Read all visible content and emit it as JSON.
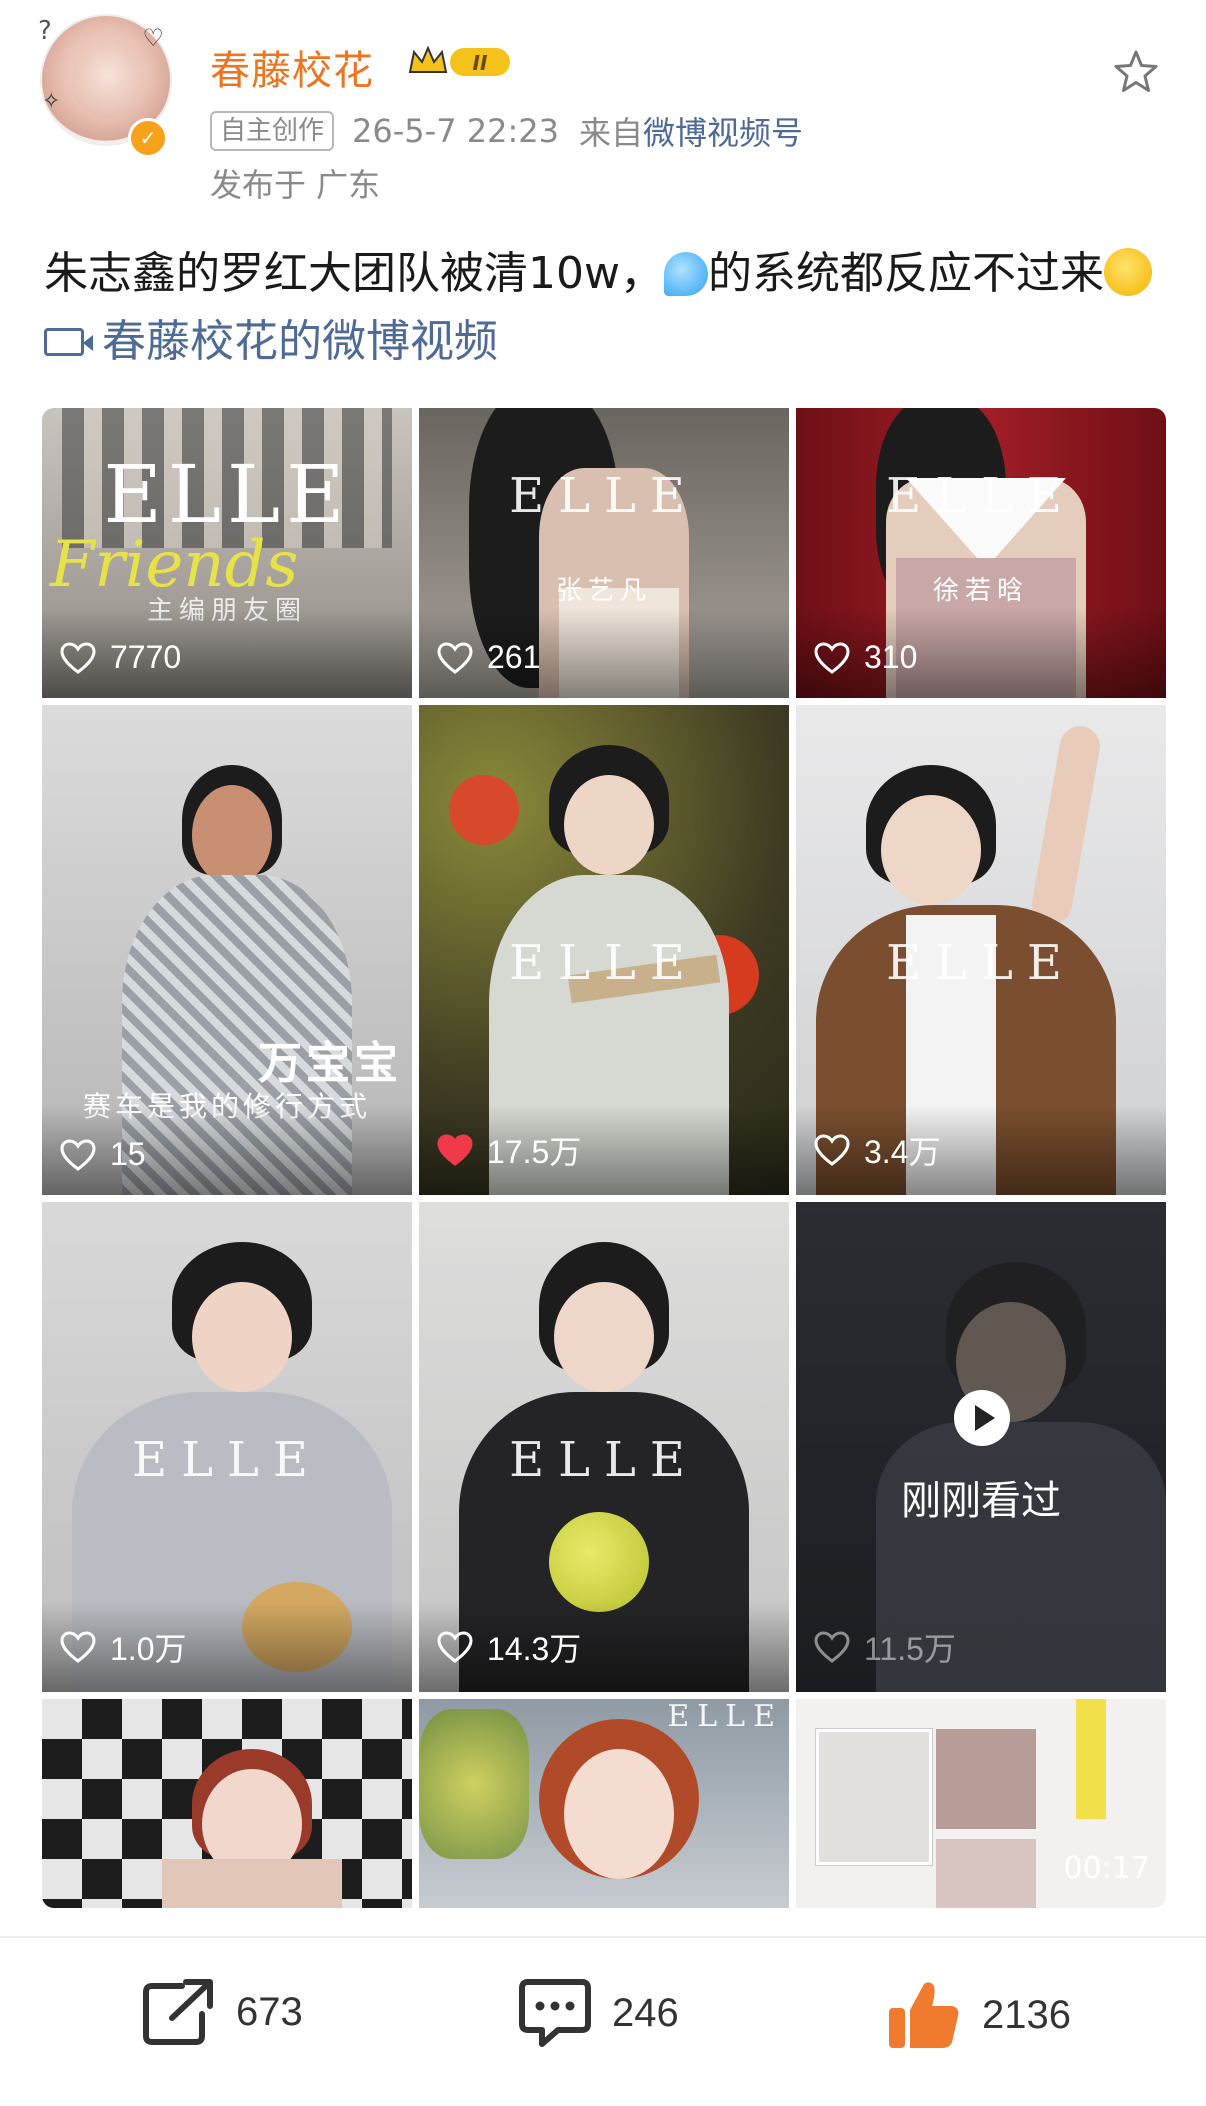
{
  "post": {
    "username": "春藤校花",
    "level_badge": "II",
    "tag": "自主创作",
    "time": "26-5-7 22:23",
    "source_prefix": "来自",
    "source": "微博视频号",
    "location": "发布于 广东",
    "text_part1": "朱志鑫的罗红大团队被清10w，",
    "text_part2": "的系统都反应不过来",
    "video_link": "春藤校花的微博视频"
  },
  "tiles": [
    {
      "likes": "7770",
      "liked": false,
      "caption": "主编朋友圈",
      "overlay_text": "Friends"
    },
    {
      "likes": "261",
      "liked": false,
      "caption": "张艺凡",
      "elle": "ELLE"
    },
    {
      "likes": "310",
      "liked": false,
      "caption": "徐若晗",
      "elle": "ELLE"
    },
    {
      "likes": "15",
      "liked": false,
      "title": "万宝宝",
      "caption": "赛车是我的修行方式"
    },
    {
      "likes": "17.5万",
      "liked": true,
      "elle": "ELLE"
    },
    {
      "likes": "3.4万",
      "liked": false,
      "elle": "ELLE"
    },
    {
      "likes": "1.0万",
      "liked": false,
      "elle": "ELLE"
    },
    {
      "likes": "14.3万",
      "liked": false,
      "elle": "ELLE"
    },
    {
      "likes": "11.5万",
      "liked": false,
      "label": "刚刚看过"
    },
    {
      "likes": "",
      "liked": false
    },
    {
      "likes": "",
      "liked": false,
      "elle": "ELLE"
    },
    {
      "likes": "",
      "liked": false,
      "duration": "00:17"
    }
  ],
  "actions": {
    "repost_count": "673",
    "comment_count": "246",
    "like_count": "2136"
  },
  "colors": {
    "username": "#ee7520",
    "link": "#4e6a96",
    "like_active": "#f03a4a",
    "thumb": "#f07a2e"
  },
  "icons": [
    "star-icon",
    "repost-icon",
    "comment-icon",
    "thumbs-up-icon",
    "heart-icon",
    "play-icon",
    "video-camera-icon"
  ]
}
